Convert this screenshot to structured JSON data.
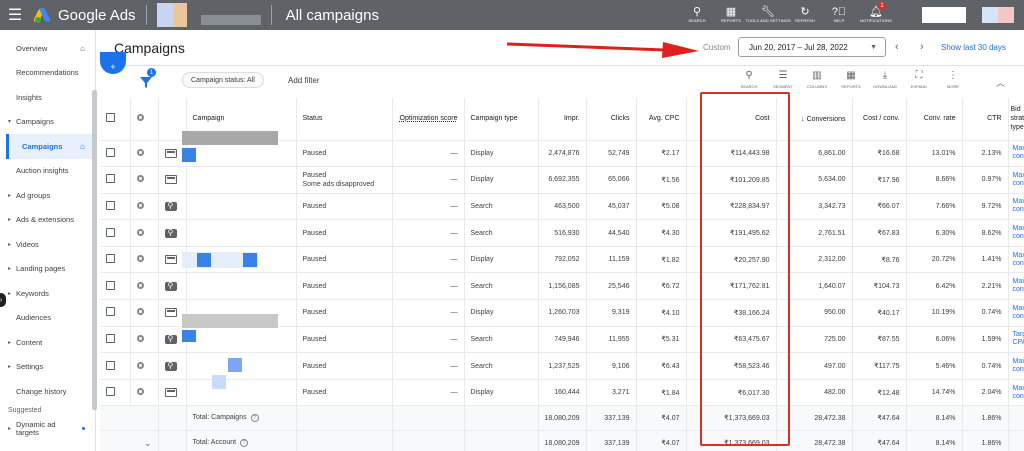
{
  "app": {
    "name": "Google Ads",
    "page_title": "All campaigns"
  },
  "top_tools": [
    {
      "id": "search",
      "label": "SEARCH",
      "icon": "search-icon"
    },
    {
      "id": "reports",
      "label": "REPORTS",
      "icon": "reports-icon"
    },
    {
      "id": "tools",
      "label": "TOOLS AND SETTINGS",
      "icon": "wrench-icon"
    },
    {
      "id": "refresh",
      "label": "REFRESH",
      "icon": "refresh-icon"
    },
    {
      "id": "help",
      "label": "HELP",
      "icon": "help-icon"
    },
    {
      "id": "notifications",
      "label": "NOTIFICATIONS",
      "icon": "bell-icon",
      "badge": "1"
    }
  ],
  "sidebar": {
    "items": [
      {
        "label": "Overview",
        "type": "item",
        "home": true
      },
      {
        "label": "Recommendations",
        "type": "item"
      },
      {
        "label": "Insights",
        "type": "item"
      },
      {
        "label": "Campaigns",
        "type": "parent",
        "expanded": true
      },
      {
        "label": "Campaigns",
        "type": "active",
        "home": true
      },
      {
        "label": "Auction insights",
        "type": "item"
      },
      {
        "label": "Ad groups",
        "type": "parent"
      },
      {
        "label": "Ads & extensions",
        "type": "parent"
      },
      {
        "label": "Videos",
        "type": "parent"
      },
      {
        "label": "Landing pages",
        "type": "parent"
      },
      {
        "label": "Keywords",
        "type": "parent"
      },
      {
        "label": "Audiences",
        "type": "item"
      },
      {
        "label": "Content",
        "type": "parent"
      },
      {
        "label": "Settings",
        "type": "parent"
      },
      {
        "label": "Change history",
        "type": "item"
      }
    ],
    "suggested_label": "Suggested",
    "suggested_item": "Dynamic ad targets"
  },
  "header": {
    "title": "Campaigns",
    "date_label": "Custom",
    "date_range": "Jun 20, 2017 – Jul 28, 2022",
    "show_last": "Show last 30 days"
  },
  "filters": {
    "badge": "1",
    "status_chip": "Campaign status: All",
    "add_filter": "Add filter"
  },
  "table_tools": [
    {
      "label": "SEARCH",
      "icon": "search-icon"
    },
    {
      "label": "SEGMENT",
      "icon": "segment-icon"
    },
    {
      "label": "COLUMNS",
      "icon": "columns-icon"
    },
    {
      "label": "REPORTS",
      "icon": "reports-icon"
    },
    {
      "label": "DOWNLOAD",
      "icon": "download-icon"
    },
    {
      "label": "EXPAND",
      "icon": "expand-icon"
    },
    {
      "label": "MORE",
      "icon": "more-icon"
    }
  ],
  "columns": {
    "campaign": "Campaign",
    "status": "Status",
    "optimization": "Optimization score",
    "type": "Campaign type",
    "impr": "Impr.",
    "clicks": "Clicks",
    "cpc": "Avg. CPC",
    "cost": "Cost",
    "conversions": "Conversions",
    "cost_conv": "Cost / conv.",
    "conv_rate": "Conv. rate",
    "ctr": "CTR",
    "bid": "Bid strategy type"
  },
  "rows": [
    {
      "status": "Paused",
      "status2": "",
      "opt": "—",
      "type": "Display",
      "kind": "display",
      "impr": "2,474,876",
      "clicks": "52,749",
      "cpc": "₹2.17",
      "cost": "₹114,443.98",
      "conv": "6,861.00",
      "cpconv": "₹16.68",
      "rate": "13.01%",
      "ctr": "2.13%",
      "bid": "Maximize conversions"
    },
    {
      "status": "Paused",
      "status2": "Some ads disapproved",
      "opt": "—",
      "type": "Display",
      "kind": "display",
      "impr": "6,692,355",
      "clicks": "65,066",
      "cpc": "₹1.56",
      "cost": "₹101,209.85",
      "conv": "5,634.00",
      "cpconv": "₹17.96",
      "rate": "8.66%",
      "ctr": "0.97%",
      "bid": "Maximize conversions"
    },
    {
      "status": "Paused",
      "status2": "",
      "opt": "—",
      "type": "Search",
      "kind": "search",
      "impr": "463,500",
      "clicks": "45,037",
      "cpc": "₹5.08",
      "cost": "₹228,834.97",
      "conv": "3,342.73",
      "cpconv": "₹66.07",
      "rate": "7.66%",
      "ctr": "9.72%",
      "bid": "Maximize conversions"
    },
    {
      "status": "Paused",
      "status2": "",
      "opt": "—",
      "type": "Search",
      "kind": "search",
      "impr": "516,930",
      "clicks": "44,540",
      "cpc": "₹4.30",
      "cost": "₹191,495.62",
      "conv": "2,761.51",
      "cpconv": "₹67.83",
      "rate": "6.30%",
      "ctr": "8.62%",
      "bid": "Maximize conversions"
    },
    {
      "status": "Paused",
      "status2": "",
      "opt": "—",
      "type": "Display",
      "kind": "display",
      "impr": "792,052",
      "clicks": "11,159",
      "cpc": "₹1.82",
      "cost": "₹20,257.90",
      "conv": "2,312.00",
      "cpconv": "₹8.76",
      "rate": "20.72%",
      "ctr": "1.41%",
      "bid": "Maximize conversions"
    },
    {
      "status": "Paused",
      "status2": "",
      "opt": "—",
      "type": "Search",
      "kind": "search",
      "impr": "1,156,085",
      "clicks": "25,546",
      "cpc": "₹6.72",
      "cost": "₹171,762.81",
      "conv": "1,640.07",
      "cpconv": "₹104.73",
      "rate": "6.42%",
      "ctr": "2.21%",
      "bid": "Maximize conversions"
    },
    {
      "status": "Paused",
      "status2": "",
      "opt": "—",
      "type": "Display",
      "kind": "display",
      "impr": "1,260,703",
      "clicks": "9,319",
      "cpc": "₹4.10",
      "cost": "₹38,166.24",
      "conv": "950.00",
      "cpconv": "₹40.17",
      "rate": "10.19%",
      "ctr": "0.74%",
      "bid": "Maximize conversions"
    },
    {
      "status": "Paused",
      "status2": "",
      "opt": "—",
      "type": "Search",
      "kind": "search",
      "impr": "749,946",
      "clicks": "11,955",
      "cpc": "₹5.31",
      "cost": "₹63,475.67",
      "conv": "725.00",
      "cpconv": "₹87.55",
      "rate": "6.06%",
      "ctr": "1.59%",
      "bid": "Target CPA"
    },
    {
      "status": "Paused",
      "status2": "",
      "opt": "—",
      "type": "Search",
      "kind": "search",
      "impr": "1,237,525",
      "clicks": "9,106",
      "cpc": "₹6.43",
      "cost": "₹58,523.46",
      "conv": "497.00",
      "cpconv": "₹117.75",
      "rate": "5.46%",
      "ctr": "0.74%",
      "bid": "Maximize conversions"
    },
    {
      "status": "Paused",
      "status2": "",
      "opt": "—",
      "type": "Display",
      "kind": "display",
      "impr": "160,444",
      "clicks": "3,271",
      "cpc": "₹1.84",
      "cost": "₹6,017.30",
      "conv": "482.00",
      "cpconv": "₹12.48",
      "rate": "14.74%",
      "ctr": "2.04%",
      "bid": "Maximize conversions"
    }
  ],
  "totals": [
    {
      "label": "Total: Campaigns",
      "impr": "18,080,209",
      "clicks": "337,139",
      "cpc": "₹4.07",
      "cost": "₹1,373,669.03",
      "conv": "28,472.38",
      "cpconv": "₹47.64",
      "rate": "8.14%",
      "ctr": "1.86%"
    },
    {
      "label": "Total: Account",
      "impr": "18,080,209",
      "clicks": "337,139",
      "cpc": "₹4.07",
      "cost": "₹1,373,669.03",
      "conv": "28,472.38",
      "cpconv": "₹47.64",
      "rate": "8.14%",
      "ctr": "1.86%"
    }
  ],
  "colors": {
    "topbar": "#5f6368",
    "accent": "#1a73e8",
    "highlight": "#d93025"
  }
}
